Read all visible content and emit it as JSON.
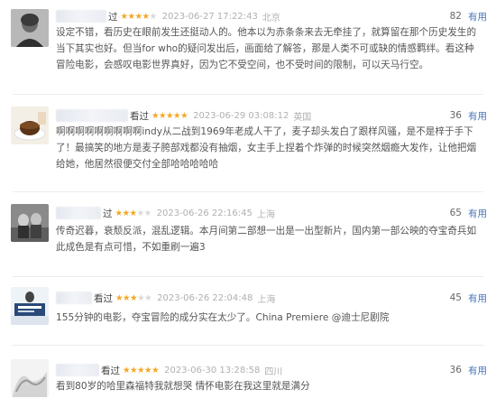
{
  "reviews": [
    {
      "watched": "过",
      "stars": "★★★★★",
      "rating": 4,
      "time": "2023-06-27 17:22:43",
      "location": "北京",
      "votes": "82",
      "useful": "有用",
      "content": "设定不错，看历史在眼前发生还挺动人的。他本以为赤条条来去无牵挂了，就算留在那个历史发生的当下其实也好。但当for who的疑问发出后，画面给了解答，那是人类不可或缺的情感羁绊。看这种冒险电影，会感叹电影世界真好，因为它不受空间，也不受时间的限制，可以天马行空。"
    },
    {
      "watched": "看过",
      "stars": "★★★★★",
      "rating": 5,
      "time": "2023-06-29 03:08:12",
      "location": "英国",
      "votes": "36",
      "useful": "有用",
      "content": "啊啊啊啊啊啊啊啊啊indy从二战到1969年老成人干了，麦子却头发白了跟样风骚，是不是梓于手下了！最搞笑的地方是麦子胯部戏都没有抽烟，女主手上捏着个炸弹的时候突然烟瘾大发作，让他把烟给她，他居然很便交付全部哈哈哈哈哈"
    },
    {
      "watched": "过",
      "stars": "★★★★★",
      "rating": 3,
      "time": "2023-06-26 22:16:45",
      "location": "上海",
      "votes": "65",
      "useful": "有用",
      "content": "传奇迟暮，衰颓反派，混乱逻辑。本月间第二部想一出是一出型新片，国内第一部公映的夺宝奇兵如此成色是有点可惜，不如重刷一遍3"
    },
    {
      "watched": "看过",
      "stars": "★★★★★",
      "rating": 3,
      "time": "2023-06-26 22:04:48",
      "location": "上海",
      "votes": "45",
      "useful": "有用",
      "content": "155分钟的电影，夺宝冒险的成分实在太少了。China Premiere @迪士尼剧院"
    },
    {
      "watched": "看过",
      "stars": "★★★★★",
      "rating": 5,
      "time": "2023-06-30 13:28:58",
      "location": "四川",
      "votes": "36",
      "useful": "有用",
      "content": "看到80岁的哈里森福特我就想哭 情怀电影在我这里就是满分"
    }
  ],
  "colors": {
    "star": "#f5a623",
    "useful": "#4a76b8",
    "meta": "#b0b0b0"
  }
}
